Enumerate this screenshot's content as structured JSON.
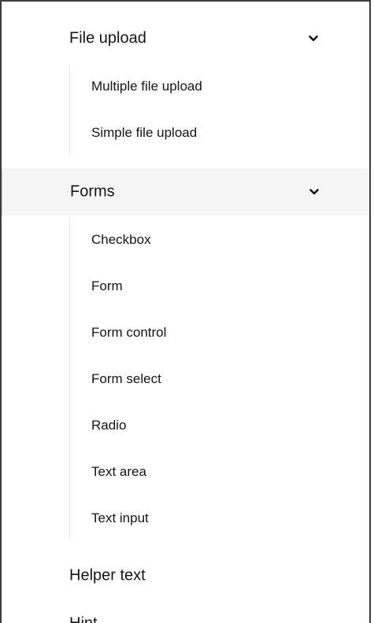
{
  "nav": {
    "file_upload": {
      "label": "File upload",
      "expanded": true,
      "items": [
        {
          "label": "Multiple file upload"
        },
        {
          "label": "Simple file upload"
        }
      ]
    },
    "forms": {
      "label": "Forms",
      "expanded": true,
      "active": true,
      "items": [
        {
          "label": "Checkbox"
        },
        {
          "label": "Form"
        },
        {
          "label": "Form control"
        },
        {
          "label": "Form select"
        },
        {
          "label": "Radio"
        },
        {
          "label": "Text area"
        },
        {
          "label": "Text input"
        }
      ]
    },
    "helper_text": {
      "label": "Helper text"
    },
    "hint": {
      "label": "Hint"
    }
  },
  "icons": {
    "expand": "chevron-down-icon"
  },
  "colors": {
    "text": "#151515",
    "active_background": "#f5f5f5",
    "rail": "#e6e6e6",
    "frame_border": "#3c3c3c"
  }
}
